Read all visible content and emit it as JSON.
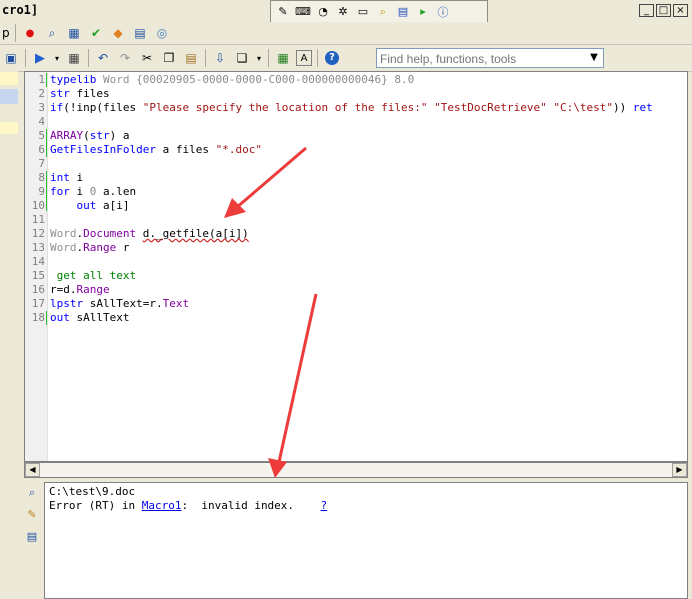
{
  "title": "cro1]",
  "menu": {
    "partial": "p"
  },
  "search": {
    "placeholder": "Find help, functions, tools"
  },
  "code_lines": [
    {
      "num": "1",
      "text": "typelib Word {00020905-0000-0000-C000-000000000046} 8.0"
    },
    {
      "num": "2",
      "text": "str files"
    },
    {
      "num": "3",
      "text": "if(!inp(files \"Please specify the location of the files:\" \"TestDocRetrieve\" \"C:\\test\")) ret"
    },
    {
      "num": "4",
      "text": ""
    },
    {
      "num": "5",
      "text": "ARRAY(str) a"
    },
    {
      "num": "6",
      "text": "GetFilesInFolder a files \"*.doc\""
    },
    {
      "num": "7",
      "text": ""
    },
    {
      "num": "8",
      "text": "int i"
    },
    {
      "num": "9",
      "text": "for i 0 a.len"
    },
    {
      "num": "10",
      "text": "\tout a[i]"
    },
    {
      "num": "11",
      "text": ""
    },
    {
      "num": "12",
      "text": "Word.Document d._getfile(a[i])"
    },
    {
      "num": "13",
      "text": "Word.Range r"
    },
    {
      "num": "14",
      "text": ""
    },
    {
      "num": "15",
      "text": " get all text"
    },
    {
      "num": "16",
      "text": "r=d.Range"
    },
    {
      "num": "17",
      "text": "lpstr sAllText=r.Text"
    },
    {
      "num": "18",
      "text": "out sAllText"
    }
  ],
  "output": {
    "line1": "C:\\test\\9.doc",
    "line2_prefix": "Error (RT) in ",
    "line2_link": "Macro1",
    "line2_msg": ":  invalid index.    ",
    "line2_help": "?"
  },
  "colors": {
    "arrow": "#ee3b3b",
    "keyword": "#0000ff",
    "type": "#8000a0",
    "string": "#a31515"
  }
}
